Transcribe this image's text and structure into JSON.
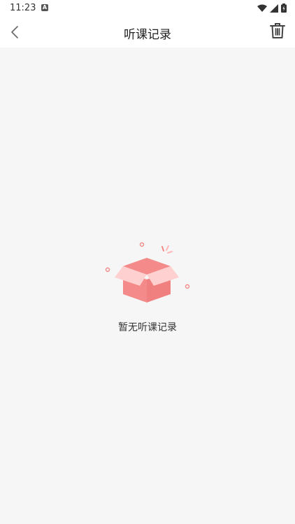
{
  "status_bar": {
    "time": "11:23",
    "notification_badge": "A",
    "icons": [
      "wifi-icon",
      "signal-icon",
      "battery-icon"
    ]
  },
  "app_bar": {
    "title": "听课记录",
    "back_icon": "chevron-left-icon",
    "delete_icon": "trash-icon"
  },
  "empty_state": {
    "icon": "empty-box-icon",
    "message": "暂无听课记录"
  },
  "colors": {
    "background": "#f6f6f6",
    "box_primary": "#f48a8a",
    "box_light": "#ffd0d0"
  }
}
